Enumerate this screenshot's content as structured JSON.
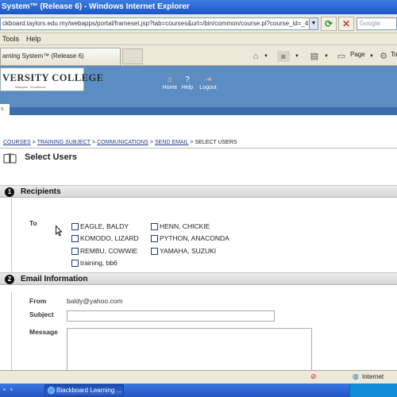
{
  "window": {
    "title": "System™ (Release 6) - Windows Internet Explorer"
  },
  "addressbar": {
    "url": "ckboard.taylors.edu.my/webapps/portal/frameset.jsp?tab=courses&url=/bin/common/course.pl?course_id=_4",
    "search_placeholder": "Google"
  },
  "menubar": {
    "items": [
      "Tools",
      "Help"
    ]
  },
  "tabbar": {
    "active_tab": "arning System™ (Release 6)",
    "page_menu": "Page",
    "tools_menu": "To"
  },
  "header": {
    "logo_text": "VERSITY COLLEGE",
    "logo_sub": "Malaysia · Excellence",
    "buttons": [
      {
        "label": "Home",
        "icon": "home-icon"
      },
      {
        "label": "Help",
        "icon": "help-icon"
      },
      {
        "label": "Logout",
        "icon": "logout-icon"
      }
    ],
    "course_tab": "s"
  },
  "breadcrumb": {
    "links": [
      "COURSES",
      "TRAINING SUBJECT",
      "COMMUNICATIONS",
      "SEND EMAIL"
    ],
    "current": "SELECT USERS",
    "separator": ">"
  },
  "page": {
    "title": "Select Users"
  },
  "recipients": {
    "number": "1",
    "title": "Recipients",
    "to_label": "To",
    "users": [
      {
        "label": "EAGLE, BALDY",
        "checked": false
      },
      {
        "label": "HENN, CHICKIE",
        "checked": false
      },
      {
        "label": "KOMODO, LIZARD",
        "checked": false
      },
      {
        "label": "PYTHON, ANACONDA",
        "checked": false
      },
      {
        "label": "REMBU, COWWIE",
        "checked": false
      },
      {
        "label": "YAMAHA, SUZUKI",
        "checked": false
      },
      {
        "label": "training, bb6",
        "checked": false
      }
    ]
  },
  "email": {
    "number": "2",
    "title": "Email Information",
    "from_label": "From",
    "from_value": "baldy@yahoo.com",
    "subject_label": "Subject",
    "subject_value": "",
    "message_label": "Message",
    "message_value": ""
  },
  "statusbar": {
    "zone": "Internet"
  },
  "taskbar": {
    "task_label": "Blackboard Learning ..."
  }
}
